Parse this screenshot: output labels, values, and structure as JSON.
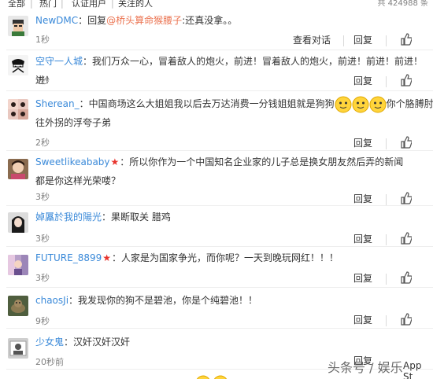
{
  "tabs": [
    "全部",
    "热门",
    "认证用户",
    "关注的人"
  ],
  "total_count": "共 424988 条",
  "colors": {
    "username": "#eb7350",
    "link_blue": "#3b8ad9",
    "vip_star": "#e8332c",
    "time": "#808080"
  },
  "actions": {
    "view_dialog": "查看对话",
    "reply": "回复",
    "like_icon": "thumbs-up-icon"
  },
  "comments": [
    {
      "user": "NewDMC",
      "prefix": "：回复",
      "mention": "@桥头算命猴腰子",
      "text": ":还真没拿。。",
      "time": "1秒",
      "has_dialog": true
    },
    {
      "user": "空守一人城",
      "text": "：我们万众一心，冒着敌人的炮火，前进！冒着敌人的炮火，前进！前进！前进！进！",
      "time": "2秒"
    },
    {
      "user": "Sherean_",
      "text": "：中国商场这么大姐姐我以后去万达消费一分钱姐姐就是狗狗",
      "text_after": "你个胳膊肘往外拐的浮夸子弟",
      "time": "2秒"
    },
    {
      "user": "Sweetlikeababy",
      "vip": "★",
      "text": "：所以你作为一个中国知名企业家的儿子总是换女朋友然后弄的新闻都是你这样光荣喽？",
      "time": "3秒"
    },
    {
      "user": "婥屭於我的陽光",
      "text": "：果断取关 腊鸡",
      "time": "3秒"
    },
    {
      "user": "FUTURE_8899",
      "vip": "★",
      "text": "：人家是为国家争光，而你呢？一天到晚玩网红！！！",
      "time": "3秒"
    },
    {
      "user": "chaosJi",
      "text": "：我发现你的狗不是碧池，你是个纯碧池！！",
      "time": "9秒"
    },
    {
      "user": "少女鬼",
      "text": "：汉奸汉奸汉奸",
      "time": "20秒前"
    }
  ],
  "watermark": "头条号 / 娱乐",
  "watermark_tail": "App St"
}
